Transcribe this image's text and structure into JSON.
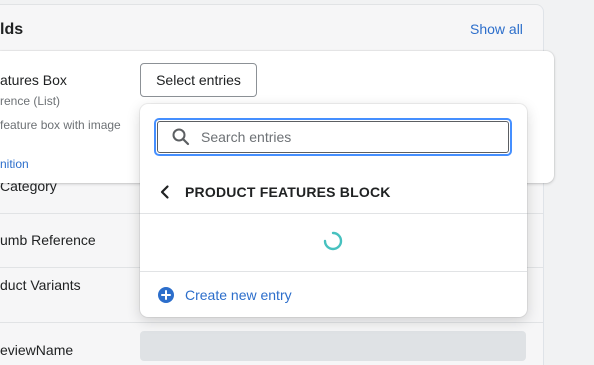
{
  "section": {
    "title": "lds",
    "show_all": "Show all"
  },
  "feature": {
    "name": "atures Box",
    "type": "rence (List)",
    "description": "feature box with image",
    "definition_link": "nition",
    "select_button": "Select entries"
  },
  "rows": [
    {
      "label": "Category"
    },
    {
      "label": "umb Reference"
    },
    {
      "label": "duct Variants"
    },
    {
      "label": "eviewName"
    }
  ],
  "popover": {
    "search_placeholder": "Search entries",
    "search_value": "",
    "back_title": "PRODUCT FEATURES BLOCK",
    "loading": true,
    "create_label": "Create new entry"
  },
  "colors": {
    "link": "#2c6ecb",
    "focus": "#458fff",
    "spinner": "#47c1bf"
  },
  "icons": {
    "search": "search-icon",
    "back": "chevron-left-icon",
    "loading": "spinner-icon",
    "create": "plus-circle-icon"
  }
}
